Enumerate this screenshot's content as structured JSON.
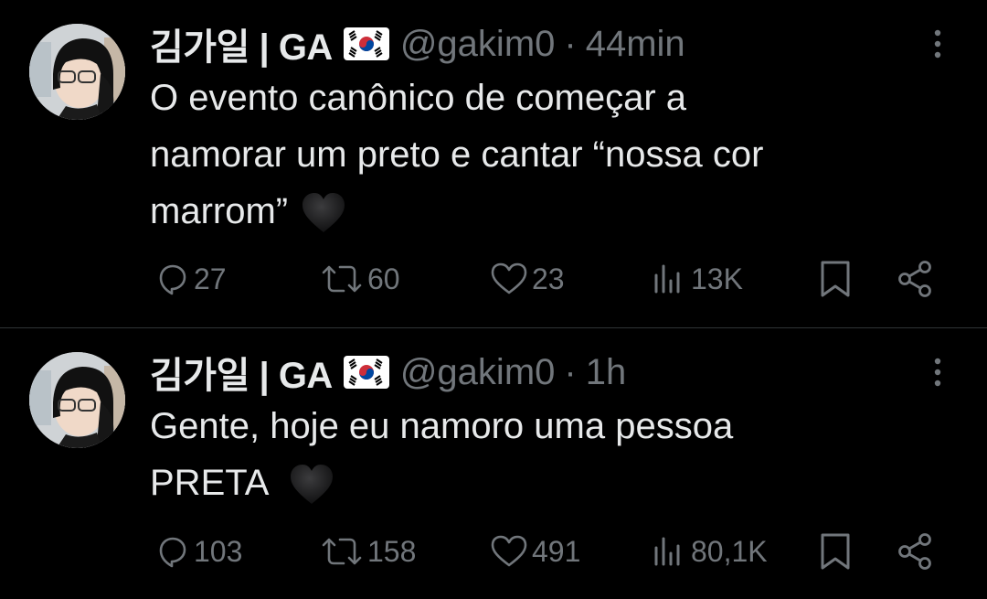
{
  "tweets": [
    {
      "display_name": "김가일 | GA",
      "flag_icon": "south-korea-flag-icon",
      "handle": "@gakim0",
      "separator": "·",
      "time": "44min",
      "text_line1": "O evento canônico de começar a",
      "text_line2": "namorar um preto e cantar “nossa cor",
      "text_line3": "marrom”",
      "emoji": "black-heart-icon",
      "actions": {
        "replies": "27",
        "retweets": "60",
        "likes": "23",
        "views": "13K"
      }
    },
    {
      "display_name": "김가일 | GA",
      "flag_icon": "south-korea-flag-icon",
      "handle": "@gakim0",
      "separator": "·",
      "time": "1h",
      "text_line1": "Gente, hoje eu namoro uma pessoa",
      "text_line2": "PRETA",
      "emoji": "black-heart-icon",
      "actions": {
        "replies": "103",
        "retweets": "158",
        "likes": "491",
        "views": "80,1K"
      }
    }
  ],
  "colors": {
    "background": "#000000",
    "primary_text": "#e7e9ea",
    "secondary_text": "#71767b",
    "divider": "#2f3336"
  }
}
